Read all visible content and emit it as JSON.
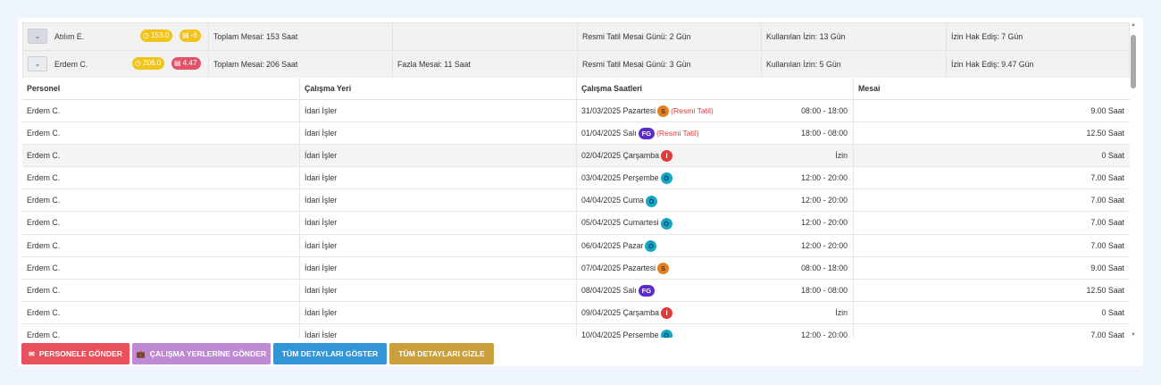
{
  "groups": [
    {
      "name": "Atılım E.",
      "badge_time": "153.0",
      "badge_leave": "-6",
      "toplam": "Toplam Mesai: 153 Saat",
      "fazla": "",
      "resmi": "Resmi Tatil Mesai Günü: 2 Gün",
      "kullanilan": "Kullanılan İzin: 13 Gün",
      "hakedis": "İzin Hak Ediş: 7 Gün",
      "toggle_icon": "chevron-down-icon"
    },
    {
      "name": "Erdem C.",
      "badge_time": "206.0",
      "badge_leave": "4.47",
      "toplam": "Toplam Mesai: 206 Saat",
      "fazla": "Fazla Mesai: 11 Saat",
      "resmi": "Resmi Tatil Mesai Günü: 3 Gün",
      "kullanilan": "Kullanılan İzin: 5 Gün",
      "hakedis": "İzin Hak Ediş: 9.47 Gün",
      "toggle_icon": "chevron-down-icon"
    }
  ],
  "columns": [
    "Personel",
    "Çalışma Yeri",
    "Çalışma Saatleri",
    "Mesai"
  ],
  "rows": [
    {
      "personel": "Erdem C.",
      "yer": "İdari İşler",
      "date": "31/03/2025 Pazartesi",
      "tag": "S",
      "holiday": "(Resmi Tatil)",
      "hours": "08:00 - 18:00",
      "mesai": "9.00 Saat"
    },
    {
      "personel": "Erdem C.",
      "yer": "İdari İşler",
      "date": "01/04/2025 Salı",
      "tag": "FG",
      "holiday": "(Resmi Tatil)",
      "hours": "18:00 - 08:00",
      "mesai": "12.50 Saat"
    },
    {
      "personel": "Erdem C.",
      "yer": "İdari İşler",
      "date": "02/04/2025 Çarşamba",
      "tag": "İ",
      "holiday": "",
      "hours": "İzin",
      "mesai": "0 Saat"
    },
    {
      "personel": "Erdem C.",
      "yer": "İdari İşler",
      "date": "03/04/2025 Perşembe",
      "tag": "Ö",
      "holiday": "",
      "hours": "12:00 - 20:00",
      "mesai": "7.00 Saat"
    },
    {
      "personel": "Erdem C.",
      "yer": "İdari İşler",
      "date": "04/04/2025 Cuma",
      "tag": "Ö",
      "holiday": "",
      "hours": "12:00 - 20:00",
      "mesai": "7.00 Saat"
    },
    {
      "personel": "Erdem C.",
      "yer": "İdari İşler",
      "date": "05/04/2025 Cumartesi",
      "tag": "Ö",
      "holiday": "",
      "hours": "12:00 - 20:00",
      "mesai": "7.00 Saat"
    },
    {
      "personel": "Erdem C.",
      "yer": "İdari İşler",
      "date": "06/04/2025 Pazar",
      "tag": "Ö",
      "holiday": "",
      "hours": "12:00 - 20:00",
      "mesai": "7.00 Saat"
    },
    {
      "personel": "Erdem C.",
      "yer": "İdari İşler",
      "date": "07/04/2025 Pazartesi",
      "tag": "S",
      "holiday": "",
      "hours": "08:00 - 18:00",
      "mesai": "9.00 Saat"
    },
    {
      "personel": "Erdem C.",
      "yer": "İdari İşler",
      "date": "08/04/2025 Salı",
      "tag": "FG",
      "holiday": "",
      "hours": "18:00 - 08:00",
      "mesai": "12.50 Saat"
    },
    {
      "personel": "Erdem C.",
      "yer": "İdari İşler",
      "date": "09/04/2025 Çarşamba",
      "tag": "İ",
      "holiday": "",
      "hours": "İzin",
      "mesai": "0 Saat"
    },
    {
      "personel": "Erdem C.",
      "yer": "İdari İşler",
      "date": "10/04/2025 Perşembe",
      "tag": "Ö",
      "holiday": "",
      "hours": "12:00 - 20:00",
      "mesai": "7.00 Saat"
    }
  ],
  "buttons": {
    "personele": "PERSONELE GÖNDER",
    "calisma": "ÇALIŞMA YERLERİNE GÖNDER",
    "goster": "TÜM DETAYLARI GÖSTER",
    "gizle": "TÜM DETAYLARI GİZLE"
  },
  "colors": {
    "accent_blue": "#3296d6",
    "danger": "#e8505b",
    "purple": "#c08ad3",
    "gold": "#c9a03c",
    "holiday_red": "#e03a3e"
  },
  "icons": {
    "clock": "clock-icon",
    "calendar": "calendar-icon",
    "envelope": "envelope-icon",
    "briefcase": "briefcase-icon"
  }
}
